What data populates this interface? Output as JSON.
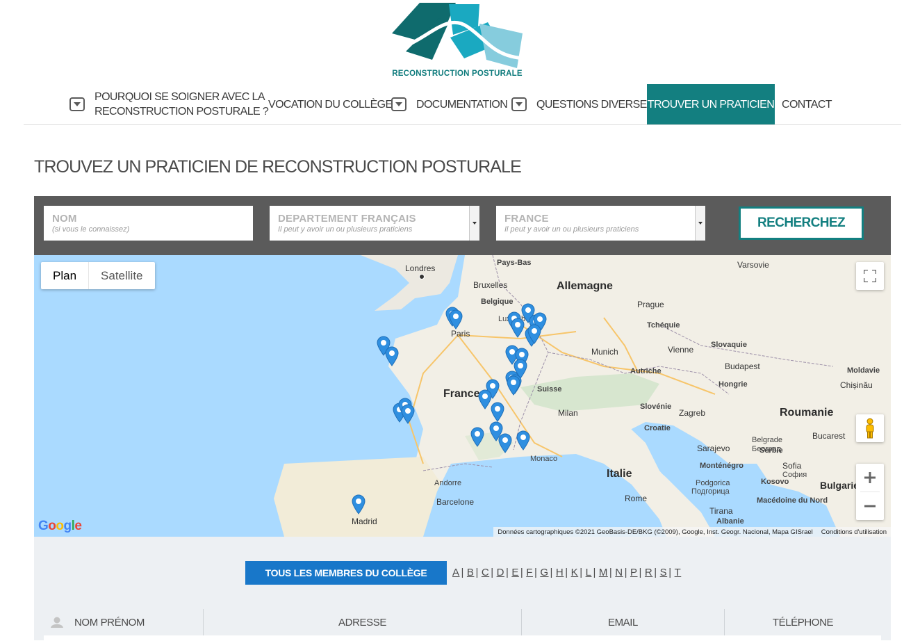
{
  "brand": {
    "logo_text": "RECONSTRUCTION POSTURALE"
  },
  "nav": {
    "items": [
      {
        "label_line1": "POURQUOI SE SOIGNER AVEC LA",
        "label_line2": "RECONSTRUCTION POSTURALE ?"
      },
      {
        "label": "VOCATION DU COLLÈGE"
      },
      {
        "label": "DOCUMENTATION"
      },
      {
        "label": "QUESTIONS DIVERSES"
      },
      {
        "label": "TROUVER UN PRATICIEN"
      },
      {
        "label": "CONTACT"
      }
    ]
  },
  "page": {
    "title": "TROUVEZ UN PRATICIEN DE RECONSTRUCTION POSTURALE"
  },
  "search": {
    "name_label": "NOM",
    "name_hint": "(si vous le connaissez)",
    "dept_label": "DEPARTEMENT FRANÇAIS",
    "dept_hint": "Il peut y avoir un ou plusieurs praticiens",
    "country_label": "FRANCE",
    "country_hint": "Il peut y avoir un ou plusieurs praticiens",
    "button": "RECHERCHEZ"
  },
  "map": {
    "type_plan": "Plan",
    "type_satellite": "Satellite",
    "attribution": "Données cartographiques ©2021 GeoBasis-DE/BKG (©2009), Google, Inst. Geogr. Nacional, Mapa GISrael",
    "terms": "Conditions d'utilisation",
    "google": "Google",
    "labels": {
      "londres": "Londres",
      "paysbas": "Pays-Bas",
      "bruxelles": "Bruxelles",
      "belgique": "Belgique",
      "allemagne": "Allemagne",
      "varsovie": "Varsovie",
      "luxembourg": "Luxembourg",
      "prague": "Prague",
      "tcheque": "Tchéquie",
      "paris": "Paris",
      "slovaquie": "Slovaquie",
      "munich": "Munich",
      "vienne": "Vienne",
      "budapest": "Budapest",
      "moldavie": "Moldavie",
      "chisinau": "Chișinău",
      "autriche": "Autriche",
      "hongrie": "Hongrie",
      "suisse": "Suisse",
      "france": "France",
      "slovenie": "Slovénie",
      "zagreb": "Zagreb",
      "roumanie": "Roumanie",
      "milan": "Milan",
      "croatie": "Croatie",
      "belgrade": "Belgrade",
      "beograd": "Београд",
      "bucarest": "Bucarest",
      "sarajevo": "Sarajevo",
      "serbie": "Serbie",
      "monaco": "Monaco",
      "italie": "Italie",
      "sofia": "Sofia",
      "sofia_cyr": "София",
      "andorre": "Andorre",
      "montenegro": "Monténégro",
      "podgorica": "Podgorica",
      "podgorica_cyr": "Подгорица",
      "kosovo": "Kosovo",
      "bulgarie": "Bulgarie",
      "barcelone": "Barcelone",
      "rome": "Rome",
      "macedoine": "Macédoine du Nord",
      "madrid": "Madrid",
      "tirana": "Tirana",
      "albanie": "Albanie"
    }
  },
  "members": {
    "all_button": "TOUS LES MEMBRES DU COLLÈGE",
    "letters": [
      "A",
      "B",
      "C",
      "D",
      "E",
      "F",
      "G",
      "H",
      "K",
      "L",
      "M",
      "N",
      "P",
      "R",
      "S",
      "T"
    ],
    "columns": [
      "NOM PRÉNOM",
      "ADRESSE",
      "EMAIL",
      "TÉLÉPHONE"
    ]
  },
  "colors": {
    "brand_teal": "#137f80",
    "button_blue": "#1877c9",
    "pin_blue": "#2f8fe0"
  }
}
